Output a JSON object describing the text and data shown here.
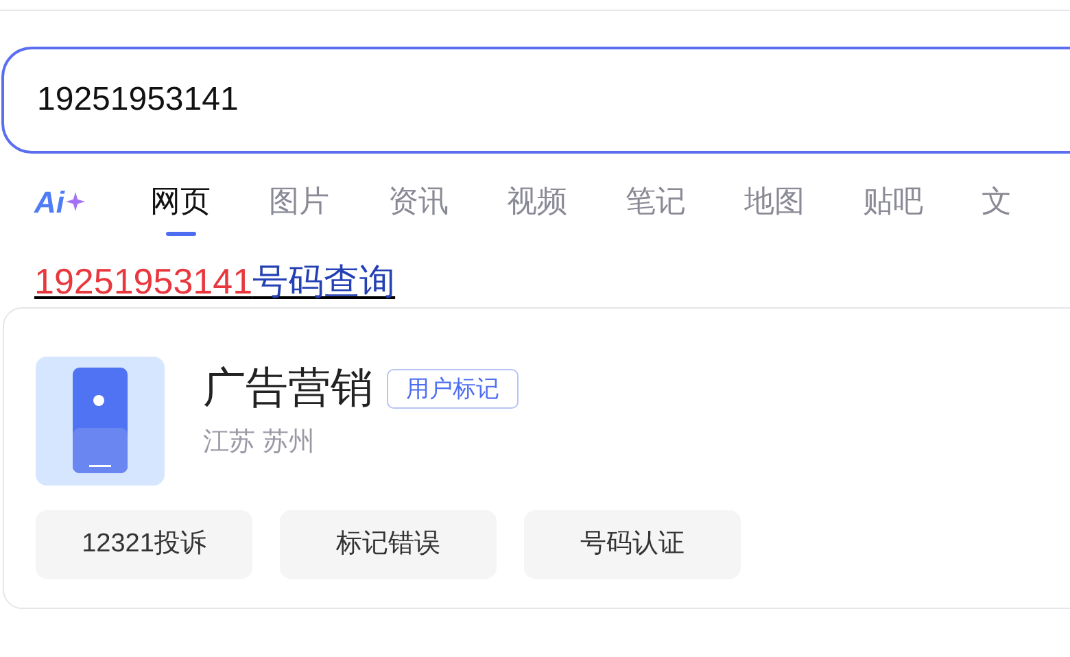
{
  "search": {
    "value": "19251953141"
  },
  "ai_logo": {
    "label": "Ai"
  },
  "tabs": [
    {
      "label": "网页",
      "selected": true
    },
    {
      "label": "图片",
      "selected": false
    },
    {
      "label": "资讯",
      "selected": false
    },
    {
      "label": "视频",
      "selected": false
    },
    {
      "label": "笔记",
      "selected": false
    },
    {
      "label": "地图",
      "selected": false
    },
    {
      "label": "贴吧",
      "selected": false
    },
    {
      "label": "文",
      "selected": false
    }
  ],
  "result": {
    "title_number": "19251953141",
    "title_rest": "号码查询"
  },
  "card": {
    "label": "广告营销",
    "badge": "用户标记",
    "location": "江苏 苏州",
    "actions": [
      "12321投诉",
      "标记错误",
      "号码认证"
    ]
  }
}
